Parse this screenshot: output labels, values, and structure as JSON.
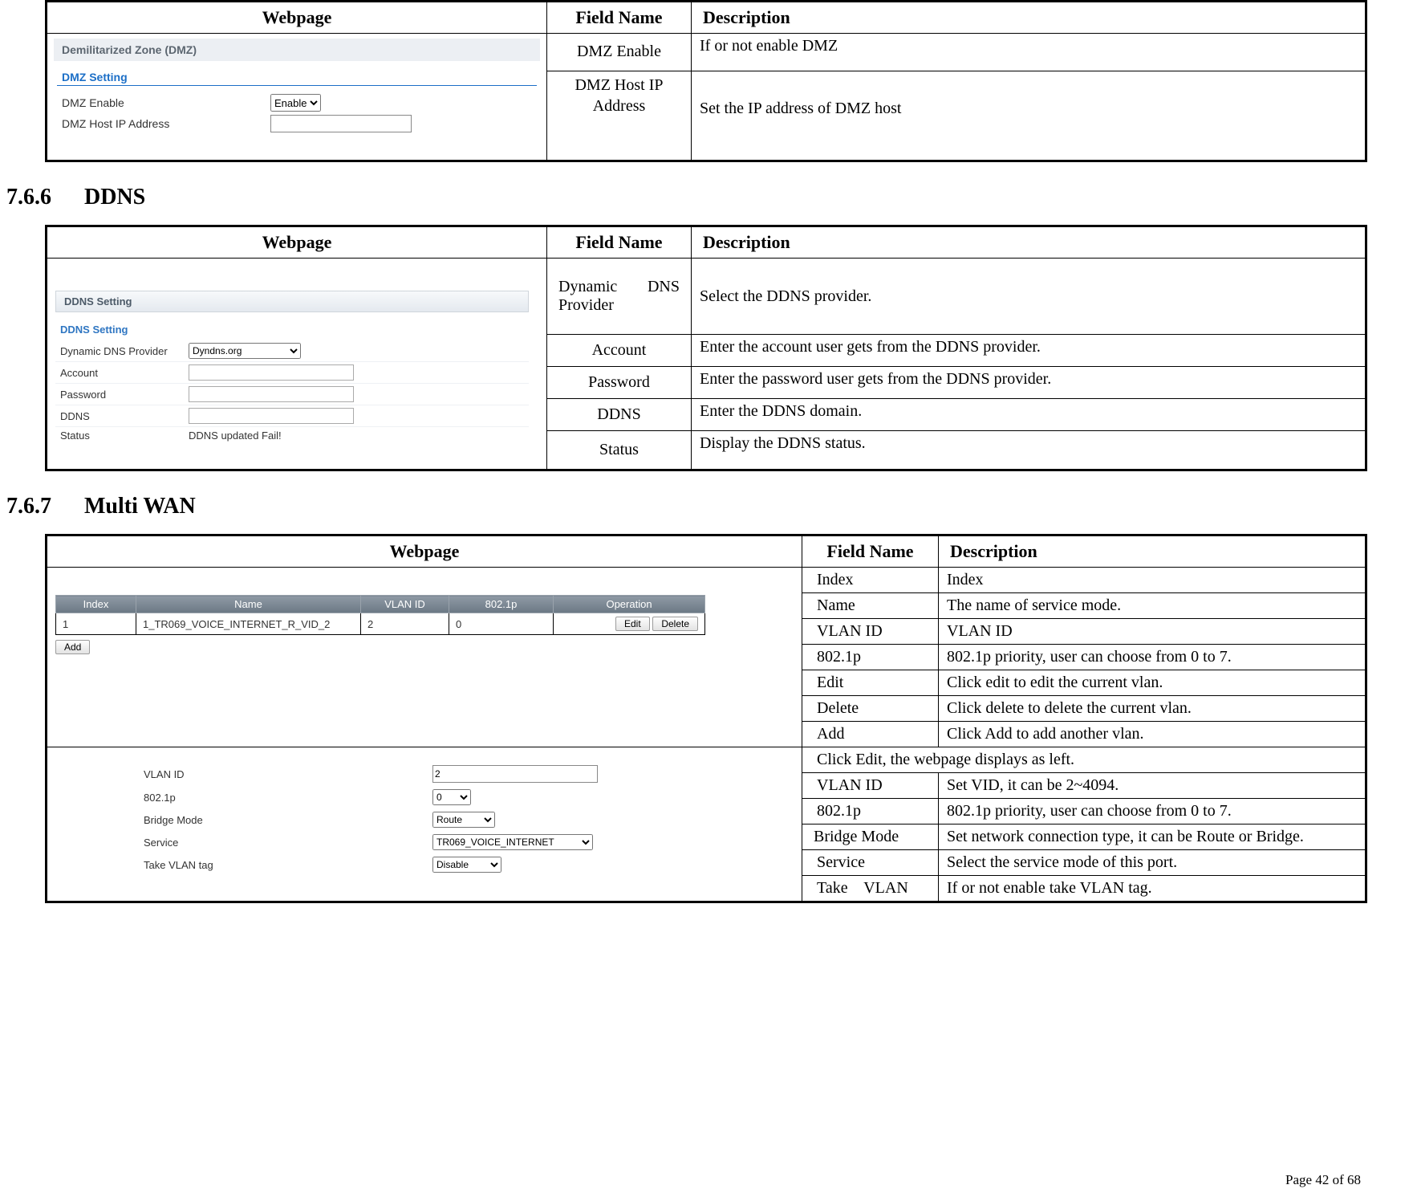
{
  "headers": {
    "webpage": "Webpage",
    "field": "Field Name",
    "description": "Description"
  },
  "dmz": {
    "panel_title": "Demilitarized Zone (DMZ)",
    "section": "DMZ Setting",
    "form": {
      "enable_label": "DMZ Enable",
      "enable_value": "Enable",
      "host_label": "DMZ Host IP Address",
      "host_value": ""
    },
    "rows": [
      {
        "field": "DMZ Enable",
        "desc": "If or not enable DMZ"
      },
      {
        "field": "DMZ Host IP Address",
        "desc": "Set the IP address of DMZ host"
      }
    ]
  },
  "sec766": {
    "num": "7.6.6",
    "title": "DDNS"
  },
  "ddns": {
    "bar_title": "DDNS Setting",
    "legend": "DDNS Setting",
    "form": {
      "provider_label": "Dynamic DNS Provider",
      "provider_value": "Dyndns.org",
      "account_label": "Account",
      "account_value": "",
      "password_label": "Password",
      "password_value": "",
      "ddns_label": "DDNS",
      "ddns_value": "",
      "status_label": "Status",
      "status_value": "DDNS updated Fail!"
    },
    "rows": [
      {
        "field_a": "Dynamic",
        "field_b": "DNS",
        "field_c": "Provider",
        "desc": "Select the DDNS provider."
      },
      {
        "field": "Account",
        "desc": "Enter the account user gets from the DDNS provider."
      },
      {
        "field": "Password",
        "desc": "Enter the password user gets from the DDNS provider."
      },
      {
        "field": "DDNS",
        "desc": "Enter the DDNS domain."
      },
      {
        "field": "Status",
        "desc": "Display the DDNS status."
      }
    ]
  },
  "sec767": {
    "num": "7.6.7",
    "title": "Multi WAN"
  },
  "mwan": {
    "list": {
      "cols": {
        "index": "Index",
        "name": "Name",
        "vlan": "VLAN ID",
        "p": "802.1p",
        "op": "Operation"
      },
      "row": {
        "index": "1",
        "name": "1_TR069_VOICE_INTERNET_R_VID_2",
        "vlan": "2",
        "p": "0"
      },
      "buttons": {
        "edit": "Edit",
        "delete": "Delete",
        "add": "Add"
      }
    },
    "edit": {
      "vlan_label": "VLAN ID",
      "vlan_value": "2",
      "p_label": "802.1p",
      "p_value": "0",
      "bridge_label": "Bridge Mode",
      "bridge_value": "Route",
      "service_label": "Service",
      "service_value": "TR069_VOICE_INTERNET",
      "take_label": "Take VLAN tag",
      "take_value": "Disable"
    },
    "rows_top": [
      {
        "field": "Index",
        "desc": "Index"
      },
      {
        "field": "Name",
        "desc": "The name of service mode."
      },
      {
        "field": "VLAN ID",
        "desc": "VLAN ID"
      },
      {
        "field": "802.1p",
        "desc": "802.1p priority, user can choose from 0 to 7."
      },
      {
        "field": "Edit",
        "desc": "Click edit to edit the current vlan."
      },
      {
        "field": "Delete",
        "desc": "Click delete to delete the current vlan."
      },
      {
        "field": "Add",
        "desc": "Click Add to add another vlan."
      }
    ],
    "note": "Click Edit, the webpage displays as left.",
    "rows_bottom": [
      {
        "field": "VLAN ID",
        "desc": "Set VID, it can be 2~4094."
      },
      {
        "field": "802.1p",
        "desc": "802.1p priority, user can choose from 0 to 7."
      },
      {
        "field": "Bridge Mode",
        "desc": "Set network connection type, it can be Route or Bridge."
      },
      {
        "field": "Service",
        "desc": "Select the service mode of this port."
      },
      {
        "field": "Take    VLAN",
        "desc": "If or not enable take VLAN tag."
      }
    ]
  },
  "footer": "Page  42  of  68"
}
